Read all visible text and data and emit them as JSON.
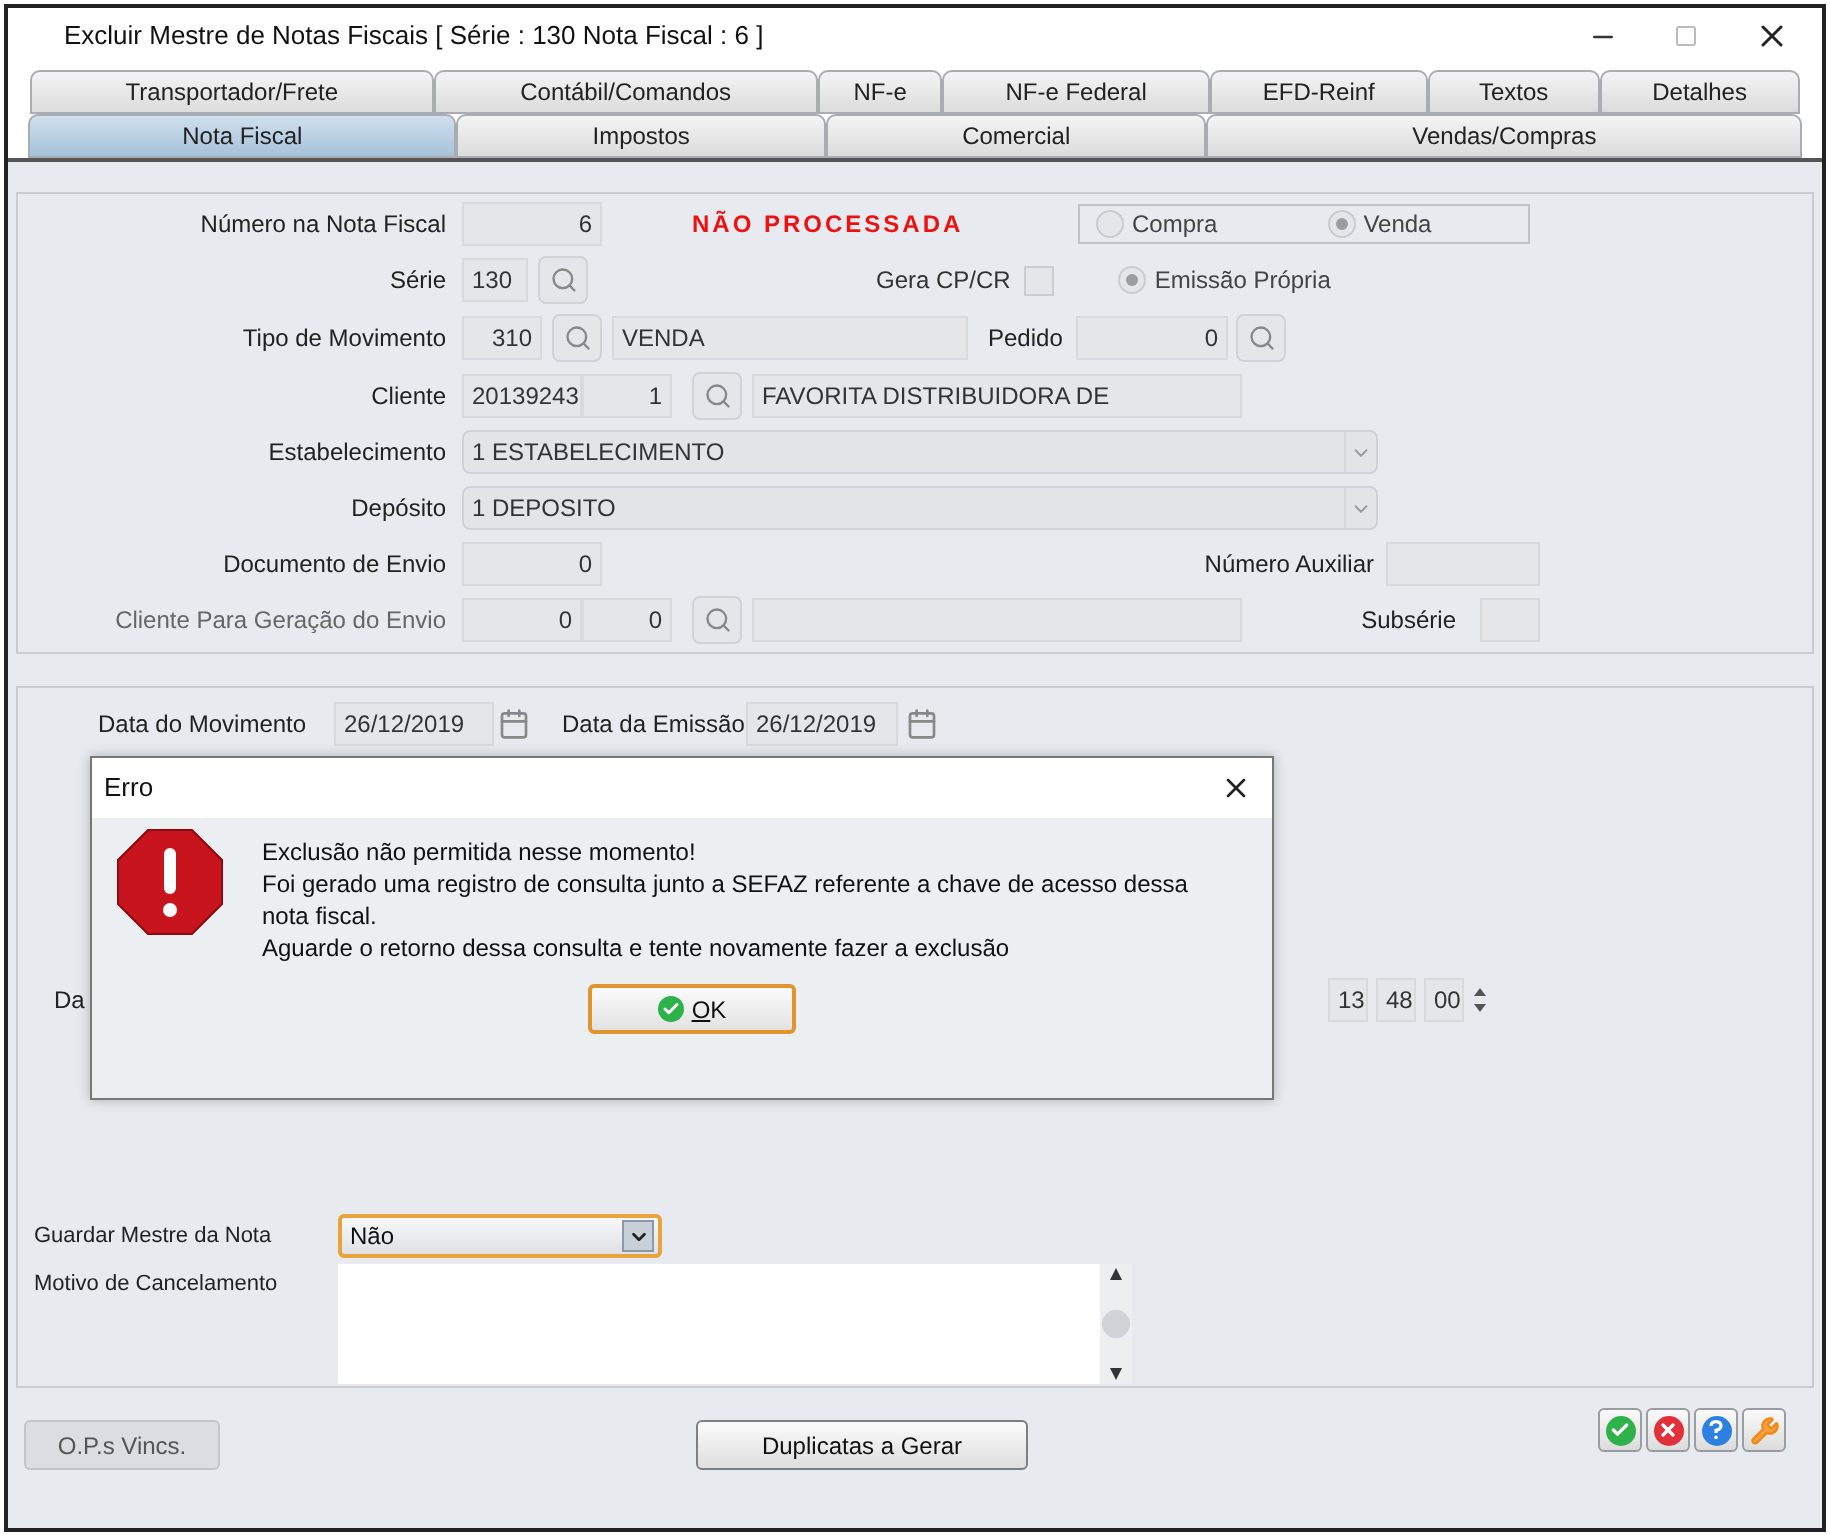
{
  "window": {
    "title": "Excluir Mestre de Notas Fiscais [ Série : 130 Nota Fiscal : 6 ]"
  },
  "tabs_row_1": [
    {
      "label": "Transportador/Frete",
      "selected": false
    },
    {
      "label": "Contábil/Comandos",
      "selected": false
    },
    {
      "label": "NF-e",
      "selected": false
    },
    {
      "label": "NF-e Federal",
      "selected": false
    },
    {
      "label": "EFD-Reinf",
      "selected": false
    },
    {
      "label": "Textos",
      "selected": false
    },
    {
      "label": "Detalhes",
      "selected": false
    }
  ],
  "tabs_row_2": [
    {
      "label": "Nota Fiscal",
      "selected": true
    },
    {
      "label": "Impostos",
      "selected": false
    },
    {
      "label": "Comercial",
      "selected": false
    },
    {
      "label": "Vendas/Compras",
      "selected": false
    }
  ],
  "header": {
    "numero": {
      "label": "Número na Nota Fiscal",
      "value": "6"
    },
    "status": "NÃO PROCESSADA",
    "operation": [
      {
        "label": "Compra",
        "selected": false
      },
      {
        "label": "Venda",
        "selected": true
      }
    ],
    "serie": {
      "label": "Série",
      "value": "130"
    },
    "gera_cp_cr": {
      "label": "Gera CP/CR",
      "checked": false
    },
    "emissao_propria": {
      "label": "Emissão Própria",
      "selected": true
    },
    "tipo_movimento": {
      "label": "Tipo de Movimento",
      "code": "310",
      "description": "VENDA"
    },
    "pedido": {
      "label": "Pedido",
      "value": "0"
    },
    "cliente": {
      "label": "Cliente",
      "code": "20139243",
      "branch": "1",
      "name": "FAVORITA DISTRIBUIDORA DE"
    },
    "estabelecimento": {
      "label": "Estabelecimento",
      "value": "1 ESTABELECIMENTO"
    },
    "deposito": {
      "label": "Depósito",
      "value": "1 DEPOSITO"
    },
    "documento_envio": {
      "label": "Documento de Envio",
      "value": "0"
    },
    "numero_auxiliar": {
      "label": "Número Auxiliar"
    },
    "cliente_envio": {
      "label": "Cliente Para Geração do Envio",
      "disabled": true,
      "code": "0",
      "branch": "0"
    },
    "subserie": {
      "label": "Subsérie"
    }
  },
  "dates": {
    "data_movimento": {
      "label": "Data do Movimento",
      "value": "26/12/2019"
    },
    "data_emissao": {
      "label": "Data da Emissão",
      "value": "26/12/2019"
    },
    "partial_label": "Da",
    "time": [
      "13",
      "48",
      "00"
    ]
  },
  "guardar_mestre": {
    "label": "Guardar Mestre da Nota",
    "value": "Não"
  },
  "motivo": {
    "label": "Motivo de Cancelamento"
  },
  "buttons": [
    {
      "label": "O.P.s Vincs.",
      "disabled": true
    },
    {
      "label": "Duplicatas a Gerar",
      "disabled": false
    }
  ],
  "toolbar_icons": [
    {
      "kind": "confirm"
    },
    {
      "kind": "cancel"
    },
    {
      "kind": "help"
    },
    {
      "kind": "tools"
    }
  ],
  "dialog": {
    "title": "Erro",
    "message": [
      "Exclusão não permitida nesse momento!",
      "Foi gerado uma registro de consulta junto a SEFAZ referente a chave de acesso dessa nota fiscal.",
      "Aguarde o retorno dessa consulta e tente novamente fazer a exclusão"
    ],
    "ok": "OK"
  }
}
